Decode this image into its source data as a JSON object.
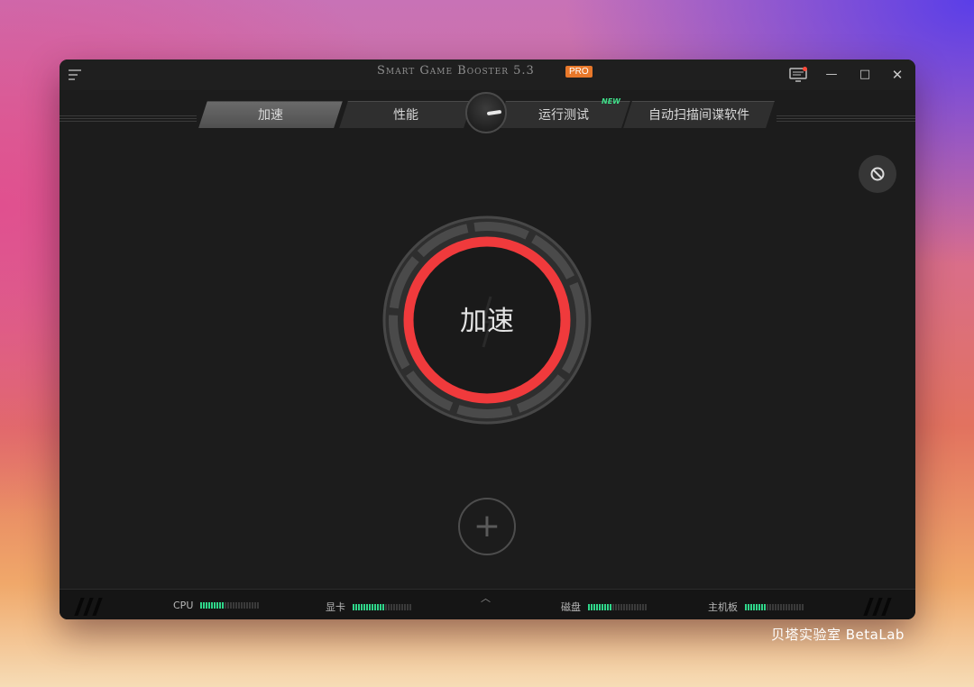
{
  "window": {
    "app_title": "Smart Game Booster 5.3",
    "pro_badge": "PRO"
  },
  "controls": {
    "minimize": "—",
    "maximize": "□",
    "close": "✕"
  },
  "tabs": [
    {
      "label": "加速",
      "active": true
    },
    {
      "label": "性能",
      "active": false
    },
    {
      "label": "运行测试",
      "active": false,
      "badge": "NEW"
    },
    {
      "label": "自动扫描间谍软件",
      "active": false
    }
  ],
  "main": {
    "boost_label": "加速",
    "ring_color": "#f03a3c",
    "add_symbol": "+"
  },
  "status": {
    "expand_symbol": "︿",
    "meters": [
      {
        "label": "CPU",
        "level": 0.4
      },
      {
        "label": "显卡",
        "level": 0.55
      },
      {
        "label": "磁盘",
        "level": 0.4
      },
      {
        "label": "主机板",
        "level": 0.35
      }
    ]
  },
  "watermark": "贝塔实验室 BetaLab",
  "icons": [
    "menu-icon",
    "monitor-icon",
    "block-icon",
    "gauge-icon",
    "plus-icon",
    "chevron-up-icon"
  ]
}
